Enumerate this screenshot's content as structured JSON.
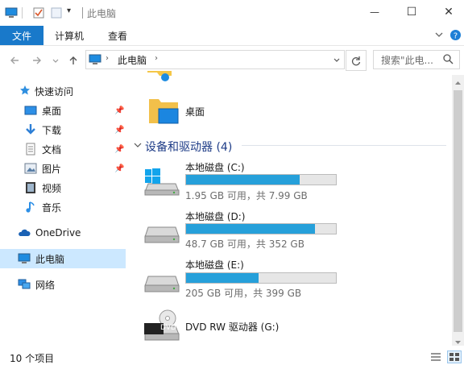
{
  "titlebar": {
    "title": "此电脑",
    "qa_dropdown": "▾",
    "minimize": "—",
    "maximize": "☐",
    "close": "✕"
  },
  "ribbon": {
    "tabs": [
      {
        "label": "文件"
      },
      {
        "label": "计算机"
      },
      {
        "label": "查看"
      }
    ],
    "collapse_icon": "chevron-down-icon",
    "help_icon": "help-icon"
  },
  "address": {
    "path_label": "此电脑",
    "search_placeholder": "搜索\"此电..."
  },
  "nav": {
    "quick_access": "快速访问",
    "items": [
      {
        "label": "桌面",
        "pinned": true
      },
      {
        "label": "下载",
        "pinned": true
      },
      {
        "label": "文档",
        "pinned": true
      },
      {
        "label": "图片",
        "pinned": true
      },
      {
        "label": "视频",
        "pinned": false
      },
      {
        "label": "音乐",
        "pinned": false
      }
    ],
    "onedrive": "OneDrive",
    "thispc": "此电脑",
    "network": "网络"
  },
  "content": {
    "folder_desktop": "桌面",
    "devices_header": "设备和驱动器 (4)",
    "drives": [
      {
        "name": "本地磁盘 (C:)",
        "detail": "1.95 GB 可用，共 7.99 GB",
        "used_fraction": 0.756
      },
      {
        "name": "本地磁盘 (D:)",
        "detail": "48.7 GB 可用，共 352 GB",
        "used_fraction": 0.862
      },
      {
        "name": "本地磁盘 (E:)",
        "detail": "205 GB 可用，共 399 GB",
        "used_fraction": 0.486
      }
    ],
    "dvd": {
      "name": "DVD RW 驱动器 (G:)",
      "badge": "DVD"
    }
  },
  "status": {
    "count": "10 个项目"
  },
  "colors": {
    "accent": "#1979ca",
    "bar_fill": "#26a0da",
    "selection": "#cce8ff"
  }
}
